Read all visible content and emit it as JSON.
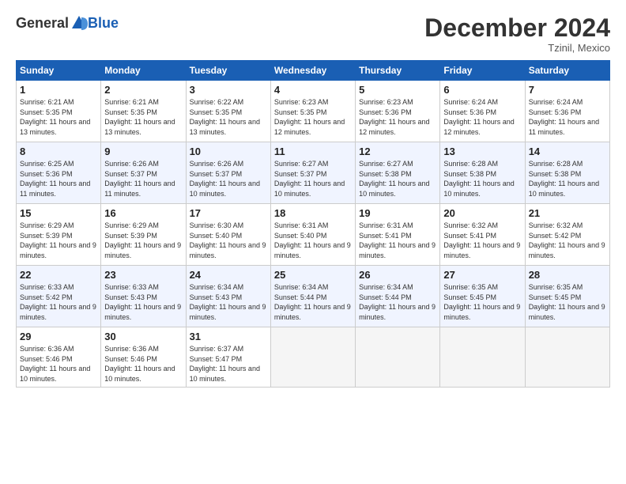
{
  "logo": {
    "general": "General",
    "blue": "Blue"
  },
  "title": "December 2024",
  "location": "Tzinil, Mexico",
  "days_header": [
    "Sunday",
    "Monday",
    "Tuesday",
    "Wednesday",
    "Thursday",
    "Friday",
    "Saturday"
  ],
  "weeks": [
    [
      {
        "day": "1",
        "sunrise": "6:21 AM",
        "sunset": "5:35 PM",
        "daylight": "11 hours and 13 minutes."
      },
      {
        "day": "2",
        "sunrise": "6:21 AM",
        "sunset": "5:35 PM",
        "daylight": "11 hours and 13 minutes."
      },
      {
        "day": "3",
        "sunrise": "6:22 AM",
        "sunset": "5:35 PM",
        "daylight": "11 hours and 13 minutes."
      },
      {
        "day": "4",
        "sunrise": "6:23 AM",
        "sunset": "5:35 PM",
        "daylight": "11 hours and 12 minutes."
      },
      {
        "day": "5",
        "sunrise": "6:23 AM",
        "sunset": "5:36 PM",
        "daylight": "11 hours and 12 minutes."
      },
      {
        "day": "6",
        "sunrise": "6:24 AM",
        "sunset": "5:36 PM",
        "daylight": "11 hours and 12 minutes."
      },
      {
        "day": "7",
        "sunrise": "6:24 AM",
        "sunset": "5:36 PM",
        "daylight": "11 hours and 11 minutes."
      }
    ],
    [
      {
        "day": "8",
        "sunrise": "6:25 AM",
        "sunset": "5:36 PM",
        "daylight": "11 hours and 11 minutes."
      },
      {
        "day": "9",
        "sunrise": "6:26 AM",
        "sunset": "5:37 PM",
        "daylight": "11 hours and 11 minutes."
      },
      {
        "day": "10",
        "sunrise": "6:26 AM",
        "sunset": "5:37 PM",
        "daylight": "11 hours and 10 minutes."
      },
      {
        "day": "11",
        "sunrise": "6:27 AM",
        "sunset": "5:37 PM",
        "daylight": "11 hours and 10 minutes."
      },
      {
        "day": "12",
        "sunrise": "6:27 AM",
        "sunset": "5:38 PM",
        "daylight": "11 hours and 10 minutes."
      },
      {
        "day": "13",
        "sunrise": "6:28 AM",
        "sunset": "5:38 PM",
        "daylight": "11 hours and 10 minutes."
      },
      {
        "day": "14",
        "sunrise": "6:28 AM",
        "sunset": "5:38 PM",
        "daylight": "11 hours and 10 minutes."
      }
    ],
    [
      {
        "day": "15",
        "sunrise": "6:29 AM",
        "sunset": "5:39 PM",
        "daylight": "11 hours and 9 minutes."
      },
      {
        "day": "16",
        "sunrise": "6:29 AM",
        "sunset": "5:39 PM",
        "daylight": "11 hours and 9 minutes."
      },
      {
        "day": "17",
        "sunrise": "6:30 AM",
        "sunset": "5:40 PM",
        "daylight": "11 hours and 9 minutes."
      },
      {
        "day": "18",
        "sunrise": "6:31 AM",
        "sunset": "5:40 PM",
        "daylight": "11 hours and 9 minutes."
      },
      {
        "day": "19",
        "sunrise": "6:31 AM",
        "sunset": "5:41 PM",
        "daylight": "11 hours and 9 minutes."
      },
      {
        "day": "20",
        "sunrise": "6:32 AM",
        "sunset": "5:41 PM",
        "daylight": "11 hours and 9 minutes."
      },
      {
        "day": "21",
        "sunrise": "6:32 AM",
        "sunset": "5:42 PM",
        "daylight": "11 hours and 9 minutes."
      }
    ],
    [
      {
        "day": "22",
        "sunrise": "6:33 AM",
        "sunset": "5:42 PM",
        "daylight": "11 hours and 9 minutes."
      },
      {
        "day": "23",
        "sunrise": "6:33 AM",
        "sunset": "5:43 PM",
        "daylight": "11 hours and 9 minutes."
      },
      {
        "day": "24",
        "sunrise": "6:34 AM",
        "sunset": "5:43 PM",
        "daylight": "11 hours and 9 minutes."
      },
      {
        "day": "25",
        "sunrise": "6:34 AM",
        "sunset": "5:44 PM",
        "daylight": "11 hours and 9 minutes."
      },
      {
        "day": "26",
        "sunrise": "6:34 AM",
        "sunset": "5:44 PM",
        "daylight": "11 hours and 9 minutes."
      },
      {
        "day": "27",
        "sunrise": "6:35 AM",
        "sunset": "5:45 PM",
        "daylight": "11 hours and 9 minutes."
      },
      {
        "day": "28",
        "sunrise": "6:35 AM",
        "sunset": "5:45 PM",
        "daylight": "11 hours and 9 minutes."
      }
    ],
    [
      {
        "day": "29",
        "sunrise": "6:36 AM",
        "sunset": "5:46 PM",
        "daylight": "11 hours and 10 minutes."
      },
      {
        "day": "30",
        "sunrise": "6:36 AM",
        "sunset": "5:46 PM",
        "daylight": "11 hours and 10 minutes."
      },
      {
        "day": "31",
        "sunrise": "6:37 AM",
        "sunset": "5:47 PM",
        "daylight": "11 hours and 10 minutes."
      },
      null,
      null,
      null,
      null
    ]
  ]
}
